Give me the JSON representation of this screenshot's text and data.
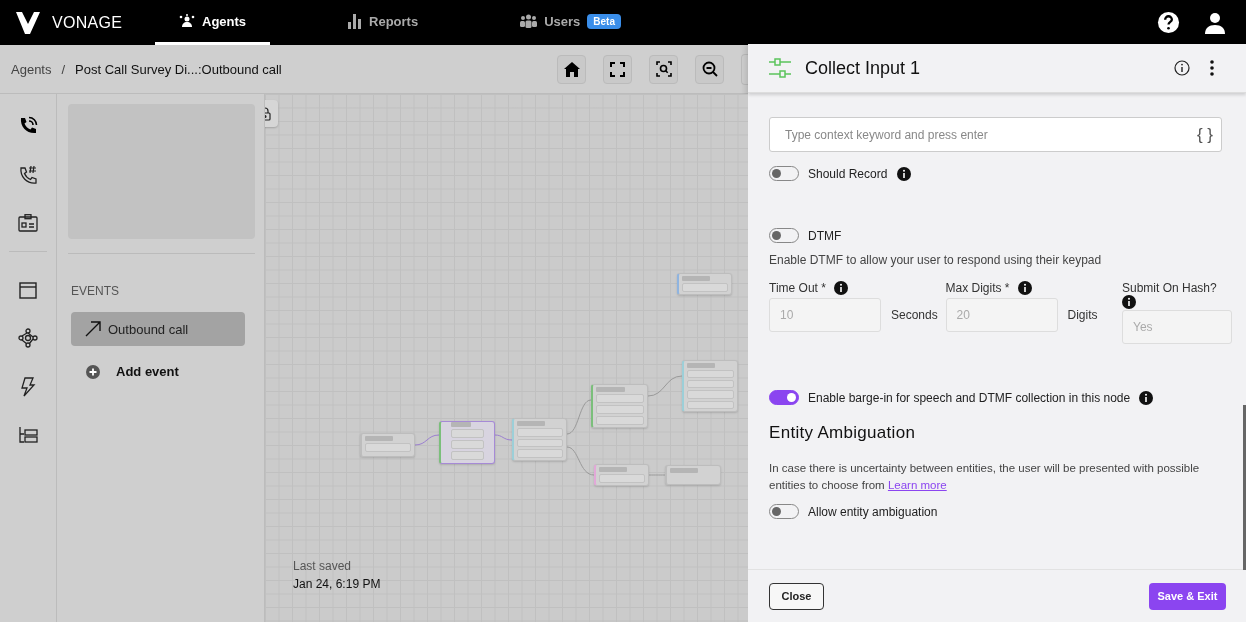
{
  "topbar": {
    "brand": "VONAGE",
    "tabs": [
      {
        "label": "Agents",
        "selected": true
      },
      {
        "label": "Reports",
        "selected": false
      },
      {
        "label": "Users",
        "selected": false,
        "badge": "Beta"
      }
    ]
  },
  "breadcrumb": {
    "root": "Agents",
    "separator": "/",
    "current": "Post Call Survey Di...:Outbound call"
  },
  "sidebar": {
    "section": "EVENTS",
    "events": [
      {
        "label": "Outbound call",
        "selected": true
      }
    ],
    "add_label": "Add event"
  },
  "canvas": {
    "last_saved_label": "Last saved",
    "last_saved": "Jan 24, 6:19 PM",
    "nodes": [
      {
        "selected": false
      },
      {
        "selected": true
      },
      {
        "selected": false
      },
      {
        "selected": false
      },
      {
        "selected": false
      },
      {
        "selected": false
      },
      {
        "selected": false
      },
      {
        "selected": false
      }
    ]
  },
  "panel": {
    "title": "Collect Input 1",
    "keyword_placeholder": "Type context keyword and press enter",
    "keyword_action": "{ }",
    "should_record": {
      "label": "Should Record",
      "on": false
    },
    "dtmf": {
      "label": "DTMF",
      "on": false,
      "hint": "Enable DTMF to allow your user to respond using their keypad"
    },
    "fields": [
      {
        "label": "Time Out *",
        "value": "10",
        "unit": "Seconds"
      },
      {
        "label": "Max Digits *",
        "value": "20",
        "unit": "Digits"
      }
    ],
    "submit_on_hash": {
      "label": "Submit On Hash?",
      "value": "Yes"
    },
    "barge_in": {
      "label": "Enable barge-in for speech and DTMF collection in this node",
      "on": true
    },
    "ambiguation": {
      "heading": "Entity Ambiguation",
      "text": "In case there is uncertainty between entities, the user will be presented with possible entities to choose from",
      "link": "Learn more",
      "toggle_label": "Allow entity ambiguation",
      "on": false
    },
    "buttons": {
      "close": "Close",
      "save": "Save & Exit"
    }
  }
}
